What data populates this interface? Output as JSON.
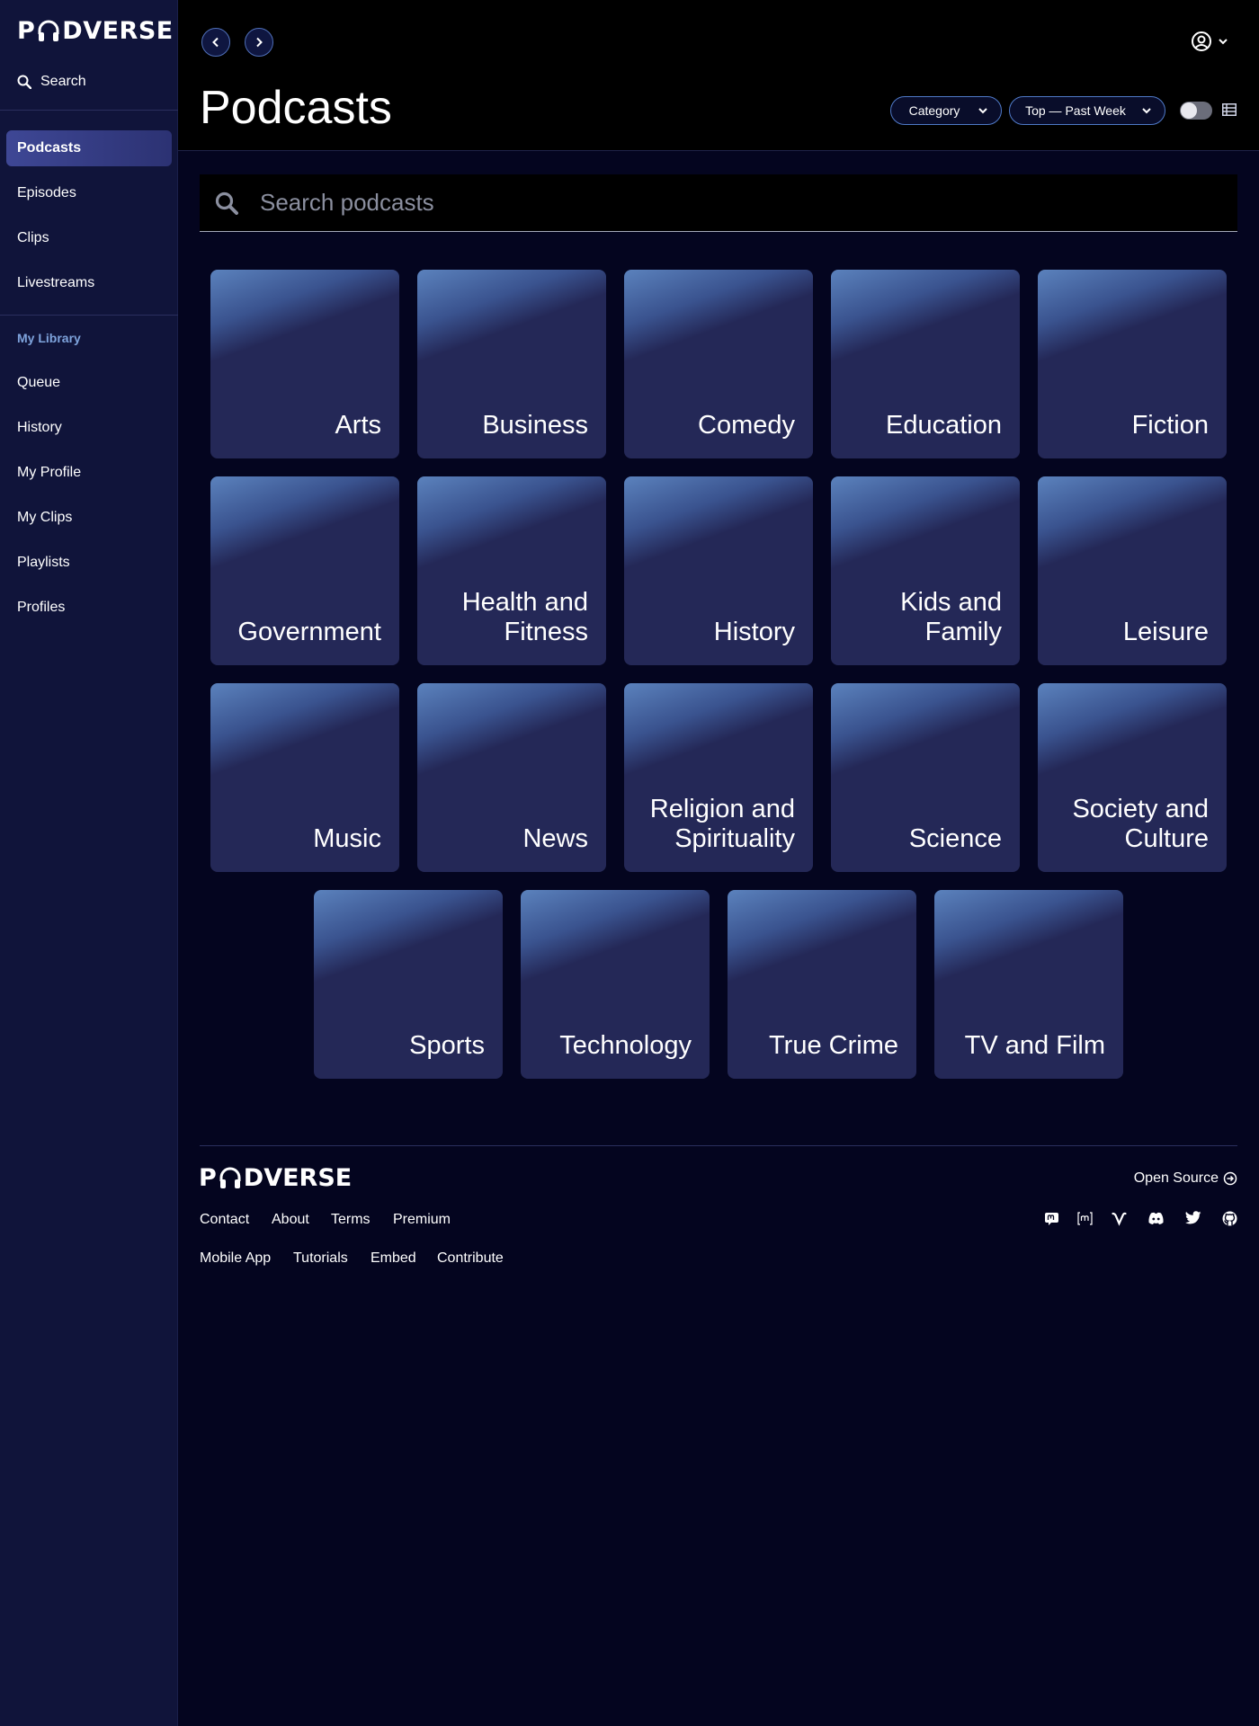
{
  "brand": {
    "logo_left": "P",
    "logo_right": "DVERSE"
  },
  "sidebar": {
    "search_label": "Search",
    "main_nav": [
      {
        "label": "Podcasts",
        "active": true
      },
      {
        "label": "Episodes"
      },
      {
        "label": "Clips"
      },
      {
        "label": "Livestreams"
      }
    ],
    "library_heading": "My Library",
    "library_nav": [
      {
        "label": "Queue"
      },
      {
        "label": "History"
      },
      {
        "label": "My Profile"
      },
      {
        "label": "My Clips"
      },
      {
        "label": "Playlists"
      },
      {
        "label": "Profiles"
      }
    ]
  },
  "header": {
    "title": "Podcasts",
    "filter_category": "Category",
    "filter_sort": "Top — Past Week"
  },
  "search": {
    "placeholder": "Search podcasts"
  },
  "categories": [
    "Arts",
    "Business",
    "Comedy",
    "Education",
    "Fiction",
    "Government",
    "Health and Fitness",
    "History",
    "Kids and Family",
    "Leisure",
    "Music",
    "News",
    "Religion and Spirituality",
    "Science",
    "Society and Culture",
    "Sports",
    "Technology",
    "True Crime",
    "TV and Film"
  ],
  "footer": {
    "open_source": "Open Source",
    "links_row1": [
      "Contact",
      "About",
      "Terms",
      "Premium"
    ],
    "links_row2": [
      "Mobile App",
      "Tutorials",
      "Embed",
      "Contribute"
    ],
    "social_icons": [
      "mastodon-icon",
      "matrix-icon",
      "v-icon",
      "discord-icon",
      "twitter-icon",
      "github-icon"
    ]
  },
  "colors": {
    "background": "#04051f",
    "sidebar": "#10143a",
    "active_nav": "#3e4795",
    "accent": "#4f79c7",
    "library_heading": "#7ea3dc",
    "tile": "#242857"
  }
}
